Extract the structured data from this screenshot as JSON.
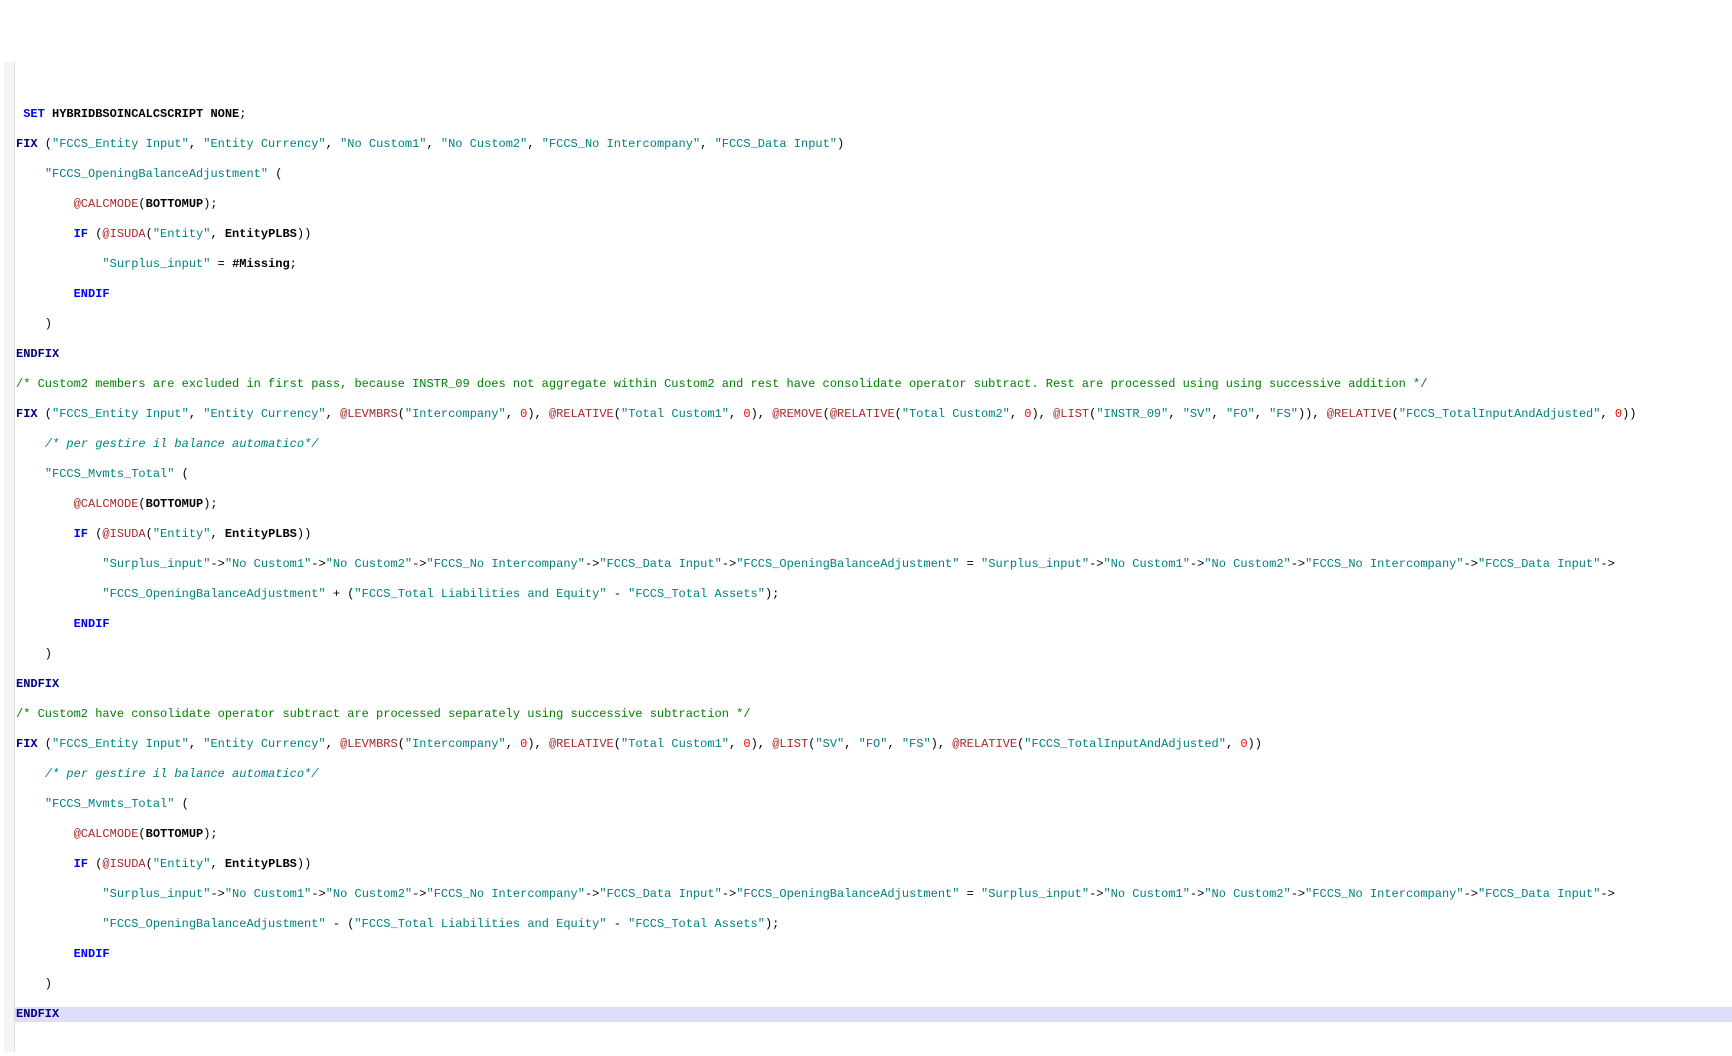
{
  "code": {
    "l1a": "SET",
    "l1b": "HYBRIDBSOINCALCSCRIPT",
    "l1c": "NONE",
    "l2a": "FIX",
    "l2s1": "\"FCCS_Entity Input\"",
    "l2s2": "\"Entity Currency\"",
    "l2s3": "\"No Custom1\"",
    "l2s4": "\"No Custom2\"",
    "l2s5": "\"FCCS_No Intercompany\"",
    "l2s6": "\"FCCS_Data Input\"",
    "l3s1": "\"FCCS_OpeningBalanceAdjustment\"",
    "l4f": "@CALCMODE",
    "l4id": "BOTTOMUP",
    "l5a": "IF",
    "l5f": "@ISUDA",
    "l5s": "\"Entity\"",
    "l5id": "EntityPLBS",
    "l6s": "\"Surplus_input\"",
    "l6m": "#Missing",
    "l7": "ENDIF",
    "l9": "ENDFIX",
    "c1": "/* Custom2 members are excluded in first pass, because INSTR_09 does not aggregate within Custom2 and rest have consolidate operator subtract. Rest are processed using using successive addition */",
    "l11a": "FIX",
    "l11s1": "\"FCCS_Entity Input\"",
    "l11s2": "\"Entity Currency\"",
    "l11f1": "@LEVMBRS",
    "l11s3": "\"Intercompany\"",
    "l11n1": "0",
    "l11f2": "@RELATIVE",
    "l11s4": "\"Total Custom1\"",
    "l11n2": "0",
    "l11f3": "@REMOVE",
    "l11f3a": "@RELATIVE",
    "l11s5": "\"Total Custom2\"",
    "l11n3": "0",
    "l11f4": "@LIST",
    "l11s6": "\"INSTR_09\"",
    "l11s7": "\"SV\"",
    "l11s8": "\"FO\"",
    "l11s9": "\"FS\"",
    "l11f5": "@RELATIVE",
    "l11s10": "\"FCCS_TotalInputAndAdjusted\"",
    "l11n4": "0",
    "c2": "/* per gestire il balance automatico*/",
    "l13s": "\"FCCS_Mvmts_Total\"",
    "l14f": "@CALCMODE",
    "l14id": "BOTTOMUP",
    "l15a": "IF",
    "l15f": "@ISUDA",
    "l15s": "\"Entity\"",
    "l15id": "EntityPLBS",
    "l16a": "\"Surplus_input\"",
    "l16b": "\"No Custom1\"",
    "l16c": "\"No Custom2\"",
    "l16d": "\"FCCS_No Intercompany\"",
    "l16e": "\"FCCS_Data Input\"",
    "l16f": "\"FCCS_OpeningBalanceAdjustment\"",
    "l16g": "\"Surplus_input\"",
    "l16h": "\"No Custom1\"",
    "l16i": "\"No Custom2\"",
    "l16j": "\"FCCS_No Intercompany\"",
    "l16k": "\"FCCS_Data Input\"",
    "l17a": "\"FCCS_OpeningBalanceAdjustment\"",
    "l17b": "\"FCCS_Total Liabilities and Equity\"",
    "l17c": "\"FCCS_Total Assets\"",
    "l18": "ENDIF",
    "l20": "ENDFIX",
    "c3": "/* Custom2 have consolidate operator subtract are processed separately using successive subtraction */",
    "l22a": "FIX",
    "l22s1": "\"FCCS_Entity Input\"",
    "l22s2": "\"Entity Currency\"",
    "l22f1": "@LEVMBRS",
    "l22s3": "\"Intercompany\"",
    "l22n1": "0",
    "l22f2": "@RELATIVE",
    "l22s4": "\"Total Custom1\"",
    "l22n2": "0",
    "l22f3": "@LIST",
    "l22s5": "\"SV\"",
    "l22s6": "\"FO\"",
    "l22s7": "\"FS\"",
    "l22f4": "@RELATIVE",
    "l22s8": "\"FCCS_TotalInputAndAdjusted\"",
    "l22n3": "0",
    "c4": "/* per gestire il balance automatico*/",
    "l24s": "\"FCCS_Mvmts_Total\"",
    "l25f": "@CALCMODE",
    "l25id": "BOTTOMUP",
    "l26a": "IF",
    "l26f": "@ISUDA",
    "l26s": "\"Entity\"",
    "l26id": "EntityPLBS",
    "l27a": "\"Surplus_input\"",
    "l27b": "\"No Custom1\"",
    "l27c": "\"No Custom2\"",
    "l27d": "\"FCCS_No Intercompany\"",
    "l27e": "\"FCCS_Data Input\"",
    "l27f": "\"FCCS_OpeningBalanceAdjustment\"",
    "l27g": "\"Surplus_input\"",
    "l27h": "\"No Custom1\"",
    "l27i": "\"No Custom2\"",
    "l27j": "\"FCCS_No Intercompany\"",
    "l27k": "\"FCCS_Data Input\"",
    "l28a": "\"FCCS_OpeningBalanceAdjustment\"",
    "l28b": "\"FCCS_Total Liabilities and Equity\"",
    "l28c": "\"FCCS_Total Assets\"",
    "l29": "ENDIF",
    "l31": "ENDFIX"
  }
}
